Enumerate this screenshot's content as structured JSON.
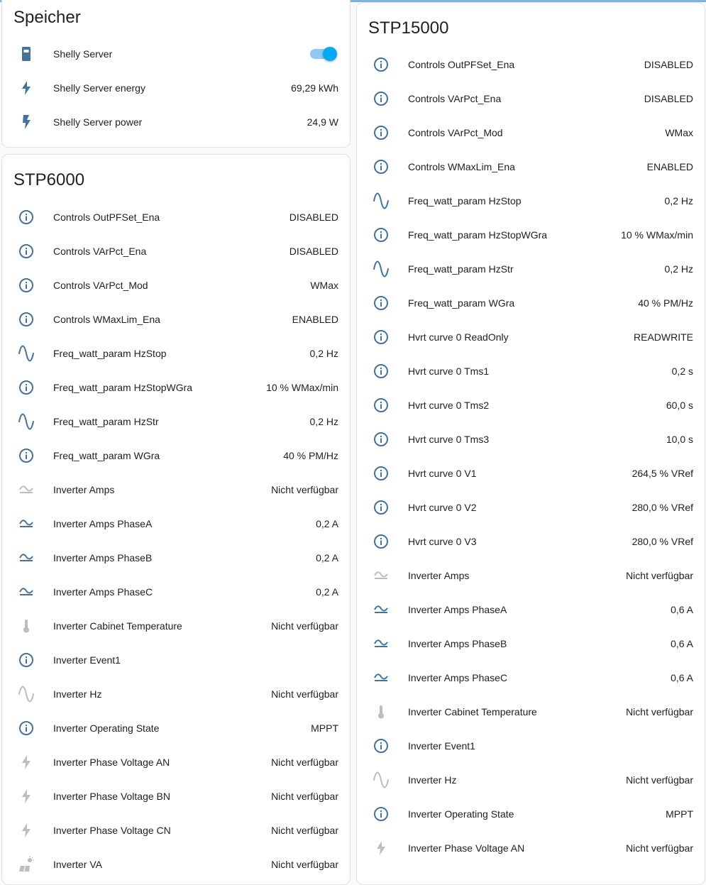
{
  "colors": {
    "icon_active": "#44739e",
    "icon_unavailable": "#bdbdbd",
    "accent": "#03a9f4"
  },
  "speicher": {
    "title": "Speicher",
    "rows": [
      {
        "label": "Shelly Server",
        "value": "",
        "icon": "battery-icon",
        "toggle": true,
        "toggle_on": true
      },
      {
        "label": "Shelly Server energy",
        "value": "69,29 kWh",
        "icon": "flash-icon"
      },
      {
        "label": "Shelly Server power",
        "value": "24,9 W",
        "icon": "flash-bold-icon"
      }
    ]
  },
  "stp6000": {
    "title": "STP6000",
    "rows": [
      {
        "label": "Controls OutPFSet_Ena",
        "value": "DISABLED",
        "icon": "info-icon"
      },
      {
        "label": "Controls VArPct_Ena",
        "value": "DISABLED",
        "icon": "info-icon"
      },
      {
        "label": "Controls VArPct_Mod",
        "value": "WMax",
        "icon": "info-icon"
      },
      {
        "label": "Controls WMaxLim_Ena",
        "value": "ENABLED",
        "icon": "info-icon"
      },
      {
        "label": "Freq_watt_param HzStop",
        "value": "0,2 Hz",
        "icon": "sine-wave-icon"
      },
      {
        "label": "Freq_watt_param HzStopWGra",
        "value": "10 % WMax/min",
        "icon": "info-icon"
      },
      {
        "label": "Freq_watt_param HzStr",
        "value": "0,2 Hz",
        "icon": "sine-wave-icon"
      },
      {
        "label": "Freq_watt_param WGra",
        "value": "40 % PM/Hz",
        "icon": "info-icon"
      },
      {
        "label": "Inverter Amps",
        "value": "Nicht verfügbar",
        "icon": "current-ac-icon",
        "unavailable": true
      },
      {
        "label": "Inverter Amps PhaseA",
        "value": "0,2 A",
        "icon": "current-ac-icon"
      },
      {
        "label": "Inverter Amps PhaseB",
        "value": "0,2 A",
        "icon": "current-ac-icon"
      },
      {
        "label": "Inverter Amps PhaseC",
        "value": "0,2 A",
        "icon": "current-ac-icon"
      },
      {
        "label": "Inverter Cabinet Temperature",
        "value": "Nicht verfügbar",
        "icon": "thermometer-icon",
        "unavailable": true
      },
      {
        "label": "Inverter Event1",
        "value": "",
        "icon": "info-icon"
      },
      {
        "label": "Inverter Hz",
        "value": "Nicht verfügbar",
        "icon": "sine-wave-icon",
        "unavailable": true
      },
      {
        "label": "Inverter Operating State",
        "value": "MPPT",
        "icon": "info-icon"
      },
      {
        "label": "Inverter Phase Voltage AN",
        "value": "Nicht verfügbar",
        "icon": "flash-icon",
        "unavailable": true
      },
      {
        "label": "Inverter Phase Voltage BN",
        "value": "Nicht verfügbar",
        "icon": "flash-icon",
        "unavailable": true
      },
      {
        "label": "Inverter Phase Voltage CN",
        "value": "Nicht verfügbar",
        "icon": "flash-icon",
        "unavailable": true
      },
      {
        "label": "Inverter VA",
        "value": "Nicht verfügbar",
        "icon": "solar-power-icon",
        "unavailable": true
      }
    ]
  },
  "stp15000": {
    "title": "STP15000",
    "rows": [
      {
        "label": "Controls OutPFSet_Ena",
        "value": "DISABLED",
        "icon": "info-icon"
      },
      {
        "label": "Controls VArPct_Ena",
        "value": "DISABLED",
        "icon": "info-icon"
      },
      {
        "label": "Controls VArPct_Mod",
        "value": "WMax",
        "icon": "info-icon"
      },
      {
        "label": "Controls WMaxLim_Ena",
        "value": "ENABLED",
        "icon": "info-icon"
      },
      {
        "label": "Freq_watt_param HzStop",
        "value": "0,2 Hz",
        "icon": "sine-wave-icon"
      },
      {
        "label": "Freq_watt_param HzStopWGra",
        "value": "10 % WMax/min",
        "icon": "info-icon"
      },
      {
        "label": "Freq_watt_param HzStr",
        "value": "0,2 Hz",
        "icon": "sine-wave-icon"
      },
      {
        "label": "Freq_watt_param WGra",
        "value": "40 % PM/Hz",
        "icon": "info-icon"
      },
      {
        "label": "Hvrt curve 0 ReadOnly",
        "value": "READWRITE",
        "icon": "info-icon"
      },
      {
        "label": "Hvrt curve 0 Tms1",
        "value": "0,2 s",
        "icon": "info-icon"
      },
      {
        "label": "Hvrt curve 0 Tms2",
        "value": "60,0 s",
        "icon": "info-icon"
      },
      {
        "label": "Hvrt curve 0 Tms3",
        "value": "10,0 s",
        "icon": "info-icon"
      },
      {
        "label": "Hvrt curve 0 V1",
        "value": "264,5 % VRef",
        "icon": "info-icon"
      },
      {
        "label": "Hvrt curve 0 V2",
        "value": "280,0 % VRef",
        "icon": "info-icon"
      },
      {
        "label": "Hvrt curve 0 V3",
        "value": "280,0 % VRef",
        "icon": "info-icon"
      },
      {
        "label": "Inverter Amps",
        "value": "Nicht verfügbar",
        "icon": "current-ac-icon",
        "unavailable": true
      },
      {
        "label": "Inverter Amps PhaseA",
        "value": "0,6 A",
        "icon": "current-ac-icon"
      },
      {
        "label": "Inverter Amps PhaseB",
        "value": "0,6 A",
        "icon": "current-ac-icon"
      },
      {
        "label": "Inverter Amps PhaseC",
        "value": "0,6 A",
        "icon": "current-ac-icon"
      },
      {
        "label": "Inverter Cabinet Temperature",
        "value": "Nicht verfügbar",
        "icon": "thermometer-icon",
        "unavailable": true
      },
      {
        "label": "Inverter Event1",
        "value": "",
        "icon": "info-icon"
      },
      {
        "label": "Inverter Hz",
        "value": "Nicht verfügbar",
        "icon": "sine-wave-icon",
        "unavailable": true
      },
      {
        "label": "Inverter Operating State",
        "value": "MPPT",
        "icon": "info-icon"
      },
      {
        "label": "Inverter Phase Voltage AN",
        "value": "Nicht verfügbar",
        "icon": "flash-icon",
        "unavailable": true
      }
    ]
  }
}
